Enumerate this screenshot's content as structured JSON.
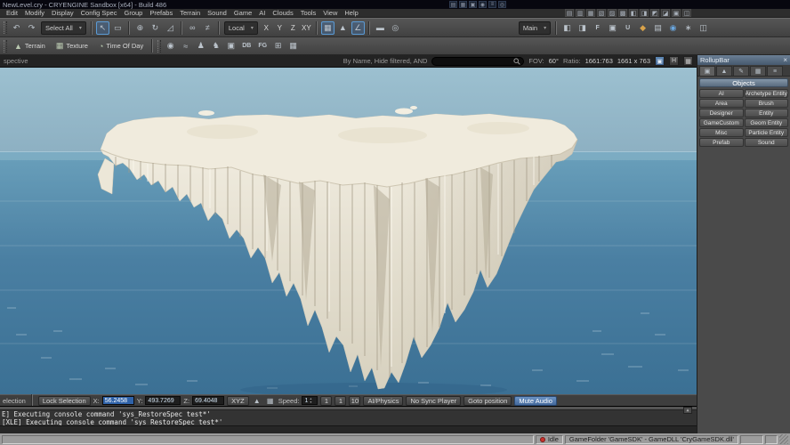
{
  "window": {
    "title": "NewLevel.cry - CRYENGINE Sandbox [x64] - Build 486"
  },
  "titlebar_icons": [
    {
      "g": "▤"
    },
    {
      "g": "▦"
    },
    {
      "g": "▣"
    },
    {
      "g": "◉"
    },
    {
      "g": "≡"
    },
    {
      "g": "◎"
    }
  ],
  "menu": {
    "items": [
      "Edit",
      "Modify",
      "Display",
      "Config Spec",
      "Group",
      "Prefabs",
      "Terrain",
      "Sound",
      "Game",
      "AI",
      "Clouds",
      "Tools",
      "View",
      "Help"
    ]
  },
  "menubar_icons": [
    {
      "g": "▤"
    },
    {
      "g": "▥"
    },
    {
      "g": "▦"
    },
    {
      "g": "▧"
    },
    {
      "g": "▨"
    },
    {
      "g": "▩"
    },
    {
      "g": "◧"
    },
    {
      "g": "◨"
    },
    {
      "g": "◩"
    },
    {
      "g": "◪"
    },
    {
      "g": "▣"
    },
    {
      "g": "◫"
    }
  ],
  "toolbar1": {
    "select_all": "Select All",
    "local": "Local",
    "axes": [
      "X",
      "Y",
      "Z",
      "XY"
    ],
    "main": "Main",
    "caret": "▾"
  },
  "t1_icons": [
    {
      "g": "↶"
    },
    {
      "g": "↷"
    },
    {
      "g": "↖"
    },
    {
      "g": "▭"
    },
    {
      "g": "⊕"
    },
    {
      "g": "↻"
    },
    {
      "g": "◿"
    },
    {
      "g": "∞"
    },
    {
      "g": "≠"
    },
    {
      "g": "▦"
    },
    {
      "g": "∠"
    },
    {
      "g": "▲"
    },
    {
      "g": "▬"
    },
    {
      "g": "◎"
    }
  ],
  "t1_right": [
    {
      "g": "◧"
    },
    {
      "g": "◨"
    },
    {
      "g": "F"
    },
    {
      "g": "▣"
    },
    {
      "g": "U"
    },
    {
      "g": "◆"
    },
    {
      "g": "▤"
    },
    {
      "g": "◉"
    },
    {
      "g": "∗"
    },
    {
      "g": "◫"
    }
  ],
  "toolbar2": {
    "terrain": "Terrain",
    "texture": "Texture",
    "time_of_day": "Time Of Day",
    "terrain_icon": "▲",
    "texture_icon": "▦",
    "clock_icon": "◔"
  },
  "t2_icons": [
    {
      "g": "◉"
    },
    {
      "g": "≈"
    },
    {
      "g": "♟"
    },
    {
      "g": "♞"
    },
    {
      "g": "▣"
    },
    {
      "g": "DB"
    },
    {
      "g": "FG"
    },
    {
      "g": "⊞"
    },
    {
      "g": "▦"
    }
  ],
  "viewport": {
    "label": "spective",
    "filter_label": "By Name, Hide filtered, AND",
    "fov_label": "FOV:",
    "fov_value": "60°",
    "ratio_label": "Ratio:",
    "ratio_value": "1661:763",
    "resolution": "1661 x 763",
    "monitor_btn": "▣",
    "helpers_btn": "H",
    "grid_btn": "▦"
  },
  "rollupbar": {
    "title": "RollupBar",
    "close": "×",
    "section": "Objects",
    "tabs": [
      {
        "g": "▣"
      },
      {
        "g": "▲"
      },
      {
        "g": "✎"
      },
      {
        "g": "▦"
      },
      {
        "g": "≡"
      }
    ],
    "buttons": [
      "AI",
      "Archetype Entity",
      "Area",
      "Brush",
      "Designer",
      "Entity",
      "GameCustom",
      "Geom Entity",
      "Misc",
      "Particle Entity",
      "Prefab",
      "Sound"
    ]
  },
  "bottombar": {
    "selection": "election",
    "lock": "Lock Selection",
    "x_label": "X:",
    "x": "56.2458",
    "y_label": "Y:",
    "y": "493.7269",
    "z_label": "Z:",
    "z": "69.4048",
    "xyz": "XYZ",
    "terrain_snap_icon": "▲",
    "grid_snap_icon": "▦",
    "speed_label": "Speed:",
    "speed": "1",
    "up": "▴",
    "down": "▾",
    "presets": [
      "1",
      "1",
      "10"
    ],
    "ai_physics": "AI/Physics",
    "no_sync": "No Sync Player",
    "goto_position": "Goto position",
    "mute_audio": "Mute Audio"
  },
  "console": {
    "lines": [
      "E] Executing console command 'sys_RestoreSpec test*'",
      "[XLE] Executing console command 'sys_RestoreSpec test*'"
    ],
    "scroll_up": "▲"
  },
  "footer": {
    "status": "Idle",
    "info": "GameFolder 'GameSDK' - GameDLL 'CryGameSDK.dll'"
  },
  "colors": {
    "accent": "#5b9bd5",
    "sky": "#93b7c9",
    "water": "#47799b",
    "island": "#e9e4d5",
    "mute_active": "#4a7ab8"
  }
}
